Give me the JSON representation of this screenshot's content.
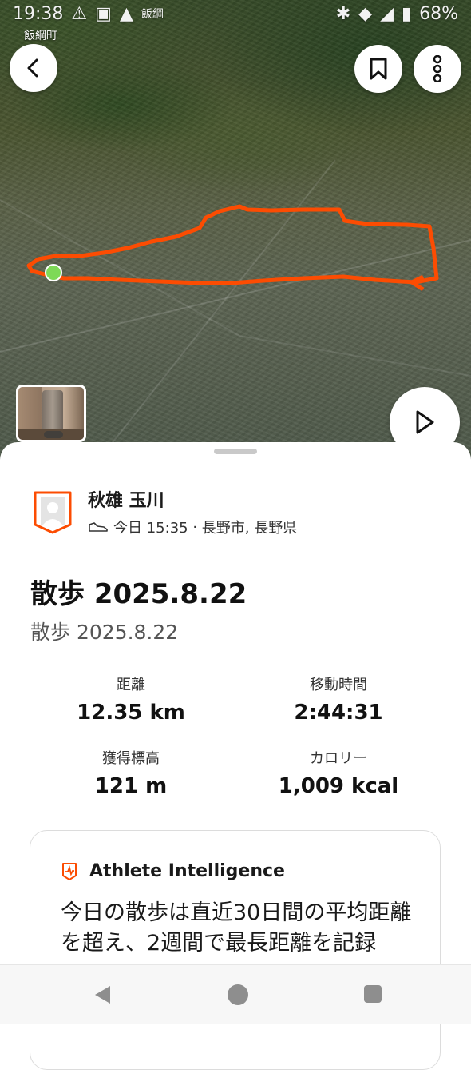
{
  "status_bar": {
    "time": "19:38",
    "carrier_label": "飯綱",
    "battery": "68%"
  },
  "map": {
    "place_label": "飯綱町",
    "route_color": "#fc4c02",
    "start_marker_color": "#7ed957"
  },
  "athlete": {
    "name": "秋雄 玉川",
    "date_time": "今日 15:35",
    "location": "長野市, 長野県"
  },
  "activity": {
    "title": "散歩 2025.8.22",
    "description": "散歩 2025.8.22"
  },
  "stats": {
    "distance": {
      "label": "距離",
      "value": "12.35 km"
    },
    "moving_time": {
      "label": "移動時間",
      "value": "2:44:31"
    },
    "elevation_gain": {
      "label": "獲得標高",
      "value": "121 m"
    },
    "calories": {
      "label": "カロリー",
      "value": "1,009 kcal"
    }
  },
  "athlete_intelligence": {
    "title": "Athlete Intelligence",
    "text": "今日の散歩は直近30日間の平均距離を超え、2週間で最長距離を記録"
  },
  "colors": {
    "brand": "#fc4c02",
    "text_primary": "#111111",
    "text_secondary": "#555555"
  },
  "icons": [
    "back-icon",
    "bookmark-icon",
    "more-icon",
    "play-icon",
    "shoe-icon",
    "ai-icon",
    "avatar-icon"
  ]
}
